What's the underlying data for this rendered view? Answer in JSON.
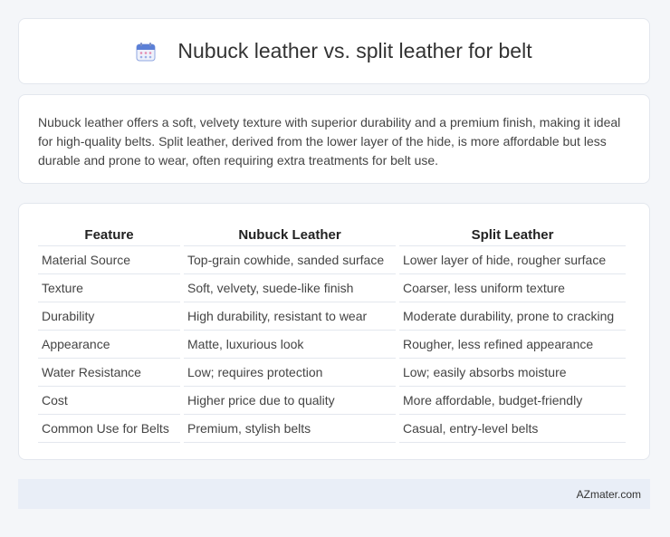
{
  "header": {
    "title": "Nubuck leather vs. split leather for belt",
    "icon": "calendar-icon"
  },
  "intro": {
    "text": "Nubuck leather offers a soft, velvety texture with superior durability and a premium finish, making it ideal for high-quality belts. Split leather, derived from the lower layer of the hide, is more affordable but less durable and prone to wear, often requiring extra treatments for belt use."
  },
  "table": {
    "headers": [
      "Feature",
      "Nubuck Leather",
      "Split Leather"
    ],
    "rows": [
      [
        "Material Source",
        "Top-grain cowhide, sanded surface",
        "Lower layer of hide, rougher surface"
      ],
      [
        "Texture",
        "Soft, velvety, suede-like finish",
        "Coarser, less uniform texture"
      ],
      [
        "Durability",
        "High durability, resistant to wear",
        "Moderate durability, prone to cracking"
      ],
      [
        "Appearance",
        "Matte, luxurious look",
        "Rougher, less refined appearance"
      ],
      [
        "Water Resistance",
        "Low; requires protection",
        "Low; easily absorbs moisture"
      ],
      [
        "Cost",
        "Higher price due to quality",
        "More affordable, budget-friendly"
      ],
      [
        "Common Use for Belts",
        "Premium, stylish belts",
        "Casual, entry-level belts"
      ]
    ]
  },
  "footer": {
    "brand": "AZmater.com"
  },
  "colors": {
    "background": "#f4f6f9",
    "card": "#ffffff",
    "footer": "#e9eef7",
    "icon_blue": "#5b7fd6",
    "icon_pink": "#e58ab0"
  }
}
